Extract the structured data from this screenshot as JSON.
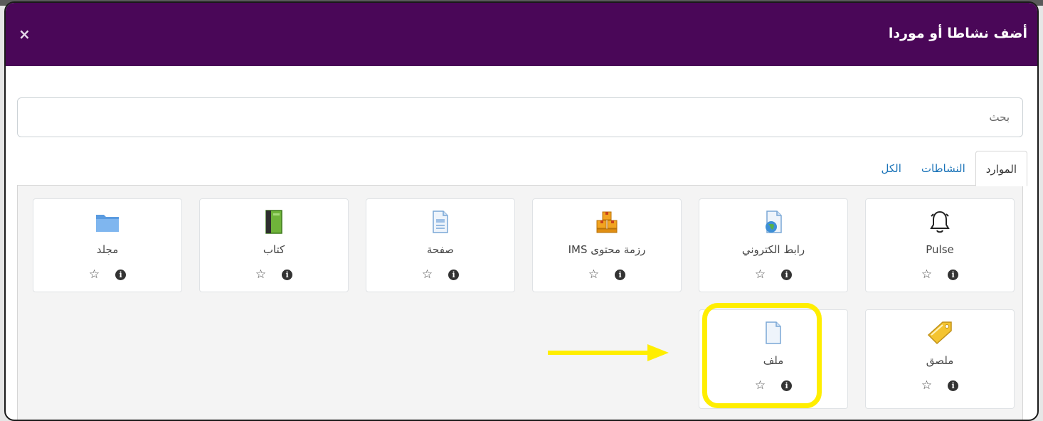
{
  "dialog": {
    "title": "أضف نشاطا أو موردا",
    "close_label": "×"
  },
  "search": {
    "placeholder": "بحث"
  },
  "tabs": [
    {
      "label": "الكل"
    },
    {
      "label": "النشاطات"
    },
    {
      "label": "الموارد",
      "active": true
    }
  ],
  "cards": [
    {
      "label": "Pulse",
      "icon": "bell-icon"
    },
    {
      "label": "رابط الكتروني",
      "icon": "url-globe-icon"
    },
    {
      "label": "رزمة محتوى IMS",
      "icon": "ims-boxes-icon"
    },
    {
      "label": "صفحة",
      "icon": "page-icon"
    },
    {
      "label": "كتاب",
      "icon": "book-icon"
    },
    {
      "label": "مجلد",
      "icon": "folder-icon"
    },
    {
      "label": "ملصق",
      "icon": "label-tag-icon"
    },
    {
      "label": "ملف",
      "icon": "file-icon",
      "highlighted": true
    }
  ],
  "card_actions": {
    "info_glyph": "i",
    "star_glyph": "☆"
  },
  "colors": {
    "header": "#4a0758",
    "highlight": "#ffee00",
    "link": "#1a73b8"
  }
}
